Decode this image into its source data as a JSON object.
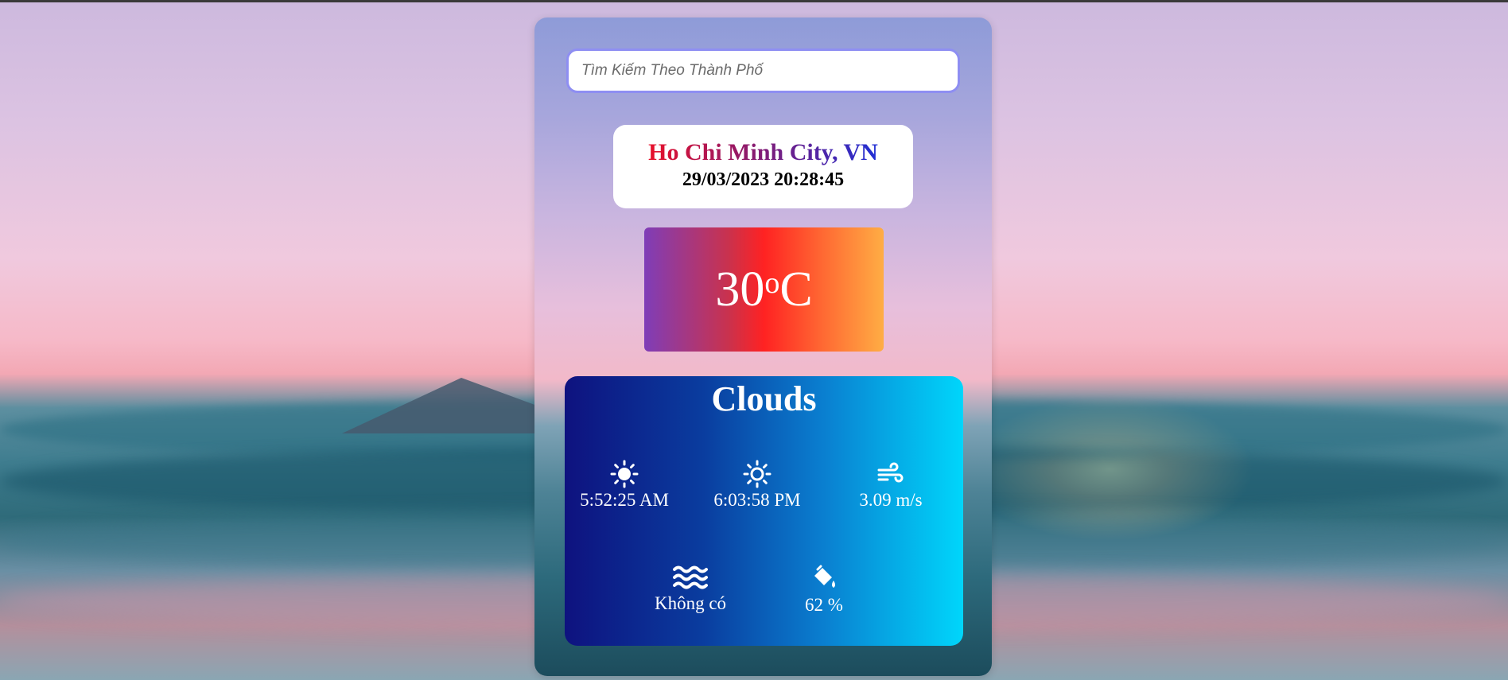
{
  "search": {
    "placeholder": "Tìm Kiếm Theo Thành Phố"
  },
  "location": {
    "city": "Ho Chi Minh City, VN",
    "datetime": "29/03/2023 20:28:45"
  },
  "temperature": {
    "value": "30",
    "degree": "o",
    "unit": "C"
  },
  "weather": {
    "main": "Clouds"
  },
  "stats": {
    "sunrise": {
      "icon": "sun-icon",
      "value": "5:52:25 AM"
    },
    "sunset": {
      "icon": "sun-outline-icon",
      "value": "6:03:58 PM"
    },
    "wind": {
      "icon": "wind-icon",
      "value": "3.09 m/s"
    },
    "sea_level": {
      "icon": "water-waves-icon",
      "value": "Không có"
    },
    "humidity": {
      "icon": "humidity-bucket-icon",
      "value": "62 %"
    }
  },
  "colors": {
    "search_border": "#8e8ef2",
    "temp_gradient": [
      "#7f3db8",
      "#ff2222",
      "#ffad44"
    ],
    "info_gradient": [
      "#0e127f",
      "#00d6fb"
    ],
    "city_gradient": [
      "#e8102a",
      "#1f2fd6"
    ]
  }
}
